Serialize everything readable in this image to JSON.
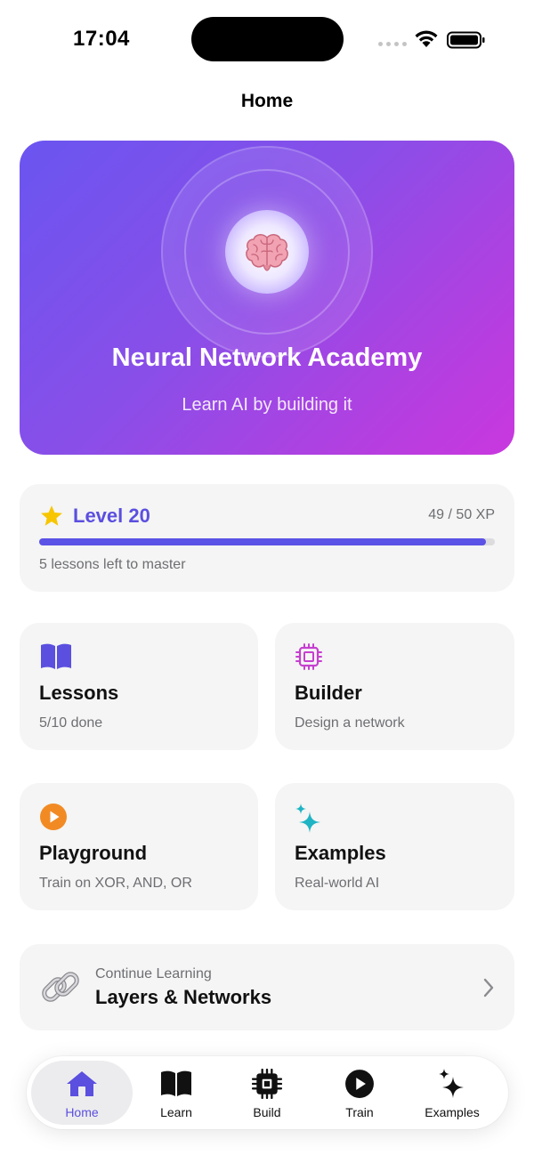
{
  "status_bar": {
    "time": "17:04"
  },
  "nav": {
    "title": "Home"
  },
  "hero": {
    "title": "Neural Network Academy",
    "subtitle": "Learn AI by building it",
    "icon": "brain-icon"
  },
  "level": {
    "label": "Level 20",
    "xp": "49 / 50 XP",
    "progress": 0.98,
    "subtitle": "5 lessons left to master"
  },
  "tiles": [
    {
      "title": "Lessons",
      "subtitle": "5/10 done",
      "icon": "book-icon",
      "color": "#5b4fe0"
    },
    {
      "title": "Builder",
      "subtitle": "Design a network",
      "icon": "cpu-icon",
      "color": "#c63fd0"
    },
    {
      "title": "Playground",
      "subtitle": "Train on XOR, AND, OR",
      "icon": "play-circle-icon",
      "color": "#f28a24"
    },
    {
      "title": "Examples",
      "subtitle": "Real-world AI",
      "icon": "sparkles-icon",
      "color": "#1fb4c4"
    }
  ],
  "continue": {
    "label": "Continue Learning",
    "title": "Layers & Networks",
    "icon": "chain-link-icon"
  },
  "tabbar": {
    "items": [
      {
        "label": "Home",
        "icon": "house-icon",
        "active": true
      },
      {
        "label": "Learn",
        "icon": "book-icon",
        "active": false
      },
      {
        "label": "Build",
        "icon": "cpu-icon",
        "active": false
      },
      {
        "label": "Train",
        "icon": "play-circle-icon",
        "active": false
      },
      {
        "label": "Examples",
        "icon": "sparkles-icon",
        "active": false
      }
    ]
  },
  "colors": {
    "accent": "#5b4fe0",
    "hero_start": "#6a55f0",
    "hero_end": "#c938de",
    "card_bg": "#f4f5f4"
  }
}
